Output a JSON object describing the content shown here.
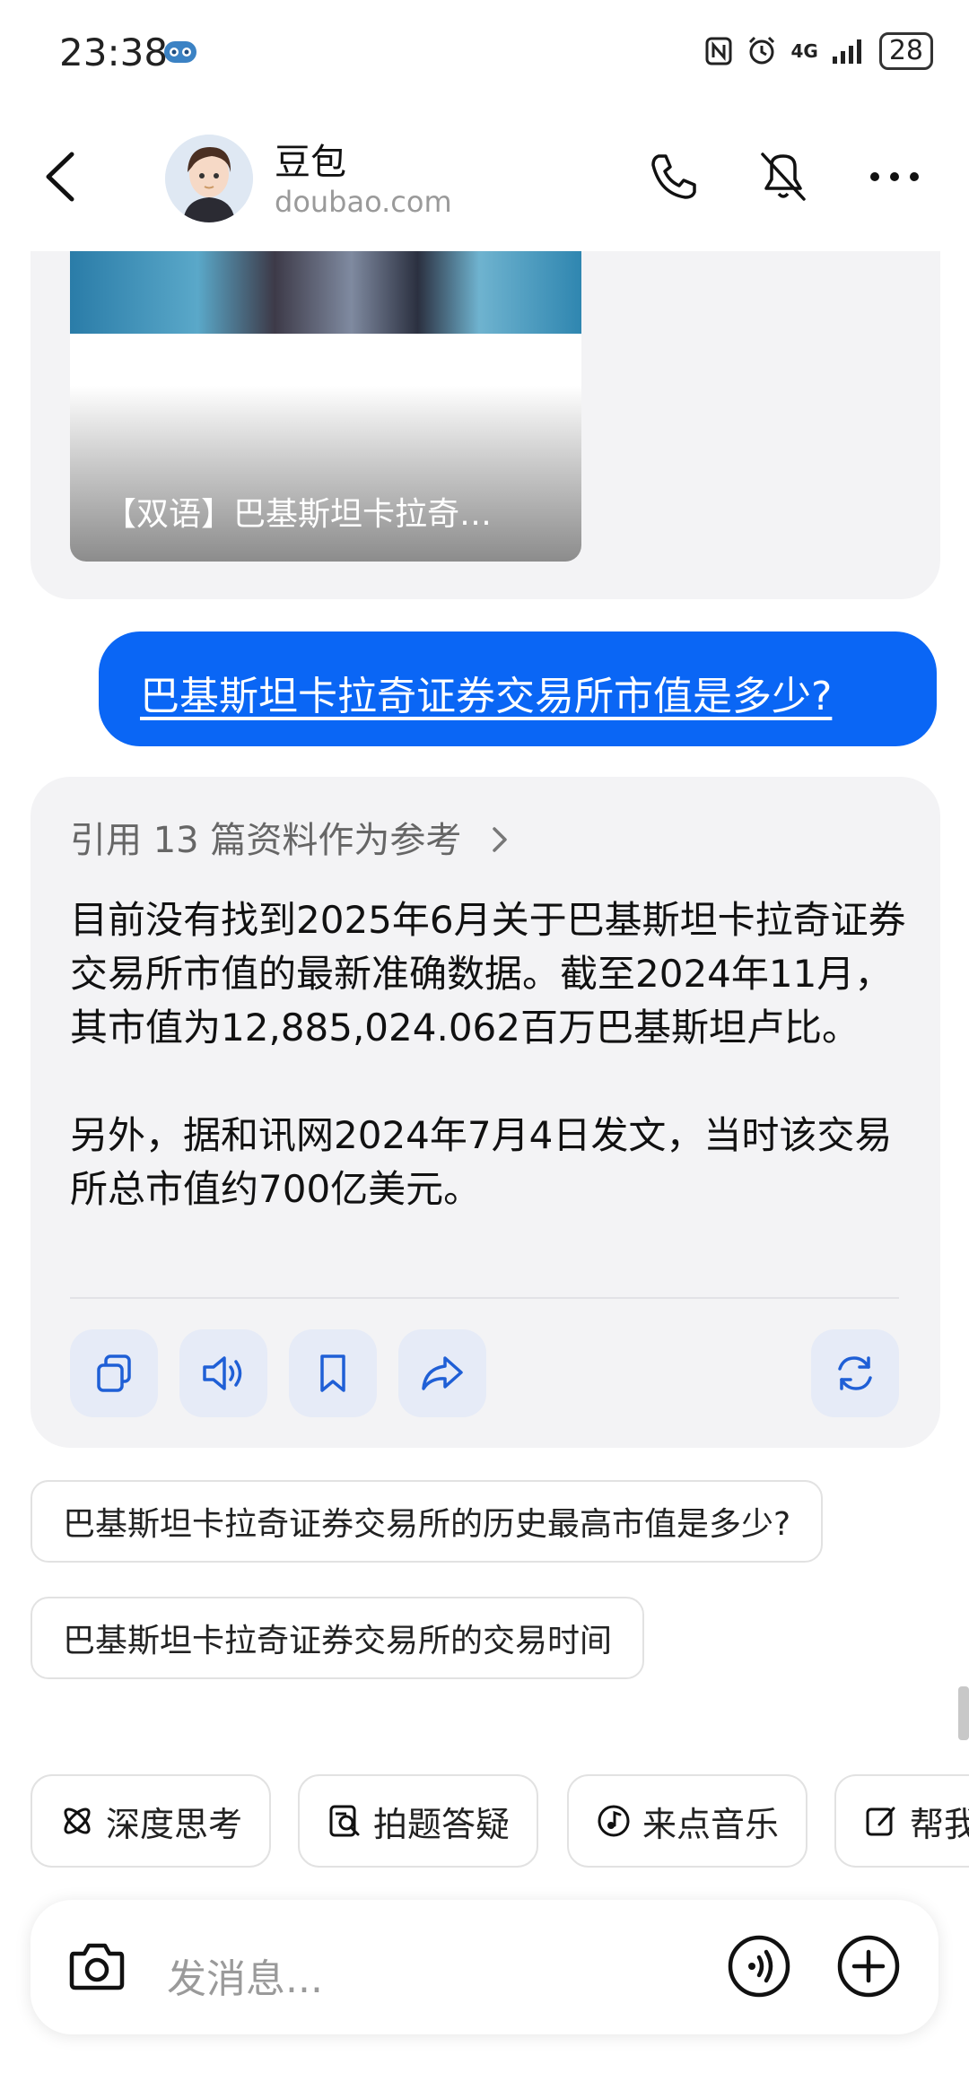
{
  "status_bar": {
    "time": "23:38",
    "network": "4G",
    "battery": "28"
  },
  "header": {
    "title": "豆包",
    "subtitle": "doubao.com"
  },
  "previous_card": {
    "caption": "【双语】巴基斯坦卡拉奇…"
  },
  "user_message": "巴基斯坦卡拉奇证券交易所市值是多少?",
  "answer": {
    "reference": "引用 13 篇资料作为参考",
    "paragraph1": "目前没有找到2025年6月关于巴基斯坦卡拉奇证券交易所市值的最新准确数据。截至2024年11月，其市值为12,885,024.062百万巴基斯坦卢比。",
    "paragraph2": "另外，据和讯网2024年7月4日发文，当时该交易所总市值约700亿美元。"
  },
  "suggestions": [
    "巴基斯坦卡拉奇证券交易所的历史最高市值是多少?",
    "巴基斯坦卡拉奇证券交易所的交易时间"
  ],
  "chips": [
    {
      "label": "深度思考",
      "icon": "atom-icon"
    },
    {
      "label": "拍题答疑",
      "icon": "scan-question-icon"
    },
    {
      "label": "来点音乐",
      "icon": "music-icon"
    },
    {
      "label": "帮我",
      "icon": "edit-icon"
    }
  ],
  "input": {
    "placeholder": "发消息..."
  },
  "colors": {
    "accent": "#0a66f5",
    "card_bg": "#f3f3f5",
    "action_bg": "#e6ebf7"
  }
}
